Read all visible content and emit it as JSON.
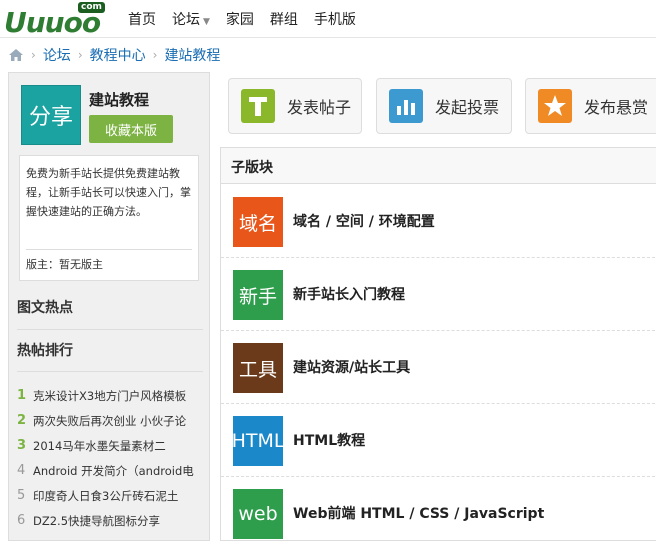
{
  "logo": {
    "text": "Uuuoo",
    "badge": "com"
  },
  "nav": {
    "items": [
      {
        "label": "首页"
      },
      {
        "label": "论坛"
      },
      {
        "label": "家园"
      },
      {
        "label": "群组"
      },
      {
        "label": "手机版"
      }
    ]
  },
  "breadcrumb": {
    "items": [
      {
        "label": "论坛"
      },
      {
        "label": "教程中心"
      },
      {
        "label": "建站教程"
      }
    ]
  },
  "forum": {
    "icon_text": "分享",
    "title": "建站教程",
    "favorite_label": "收藏本版",
    "description": "免费为新手站长提供免费建站教程，让新手站长可以快速入门，掌握快速建站的正确方法。",
    "moderator": "版主：暂无版主"
  },
  "sidebar": {
    "image_hot_heading": "图文热点",
    "hot_posts_heading": "热帖排行",
    "hot_posts": [
      {
        "rank": "1",
        "title": "克米设计X3地方门户风格模板"
      },
      {
        "rank": "2",
        "title": "两次失败后再次创业 小伙子论"
      },
      {
        "rank": "3",
        "title": "2014马年水墨矢量素材二"
      },
      {
        "rank": "4",
        "title": "Android 开发简介（android电"
      },
      {
        "rank": "5",
        "title": "印度奇人日食3公斤砖石泥土"
      },
      {
        "rank": "6",
        "title": "DZ2.5快捷导航图标分享"
      }
    ]
  },
  "actions": {
    "new_thread": "发表帖子",
    "new_poll": "发起投票",
    "new_reward": "发布悬赏"
  },
  "subforums": {
    "heading": "子版块",
    "items": [
      {
        "icon_text": "域名",
        "name": "域名 / 空间 / 环境配置",
        "color": "#e8561a"
      },
      {
        "icon_text": "新手",
        "name": "新手站长入门教程",
        "color": "#2e9e4c"
      },
      {
        "icon_text": "工具",
        "name": "建站资源/站长工具",
        "color": "#6b3a1a"
      },
      {
        "icon_text": "HTML",
        "name": "HTML教程",
        "color": "#1a88c9"
      },
      {
        "icon_text": "web",
        "name": "Web前端 HTML / CSS / JavaScript",
        "color": "#2e9e4c"
      }
    ]
  }
}
